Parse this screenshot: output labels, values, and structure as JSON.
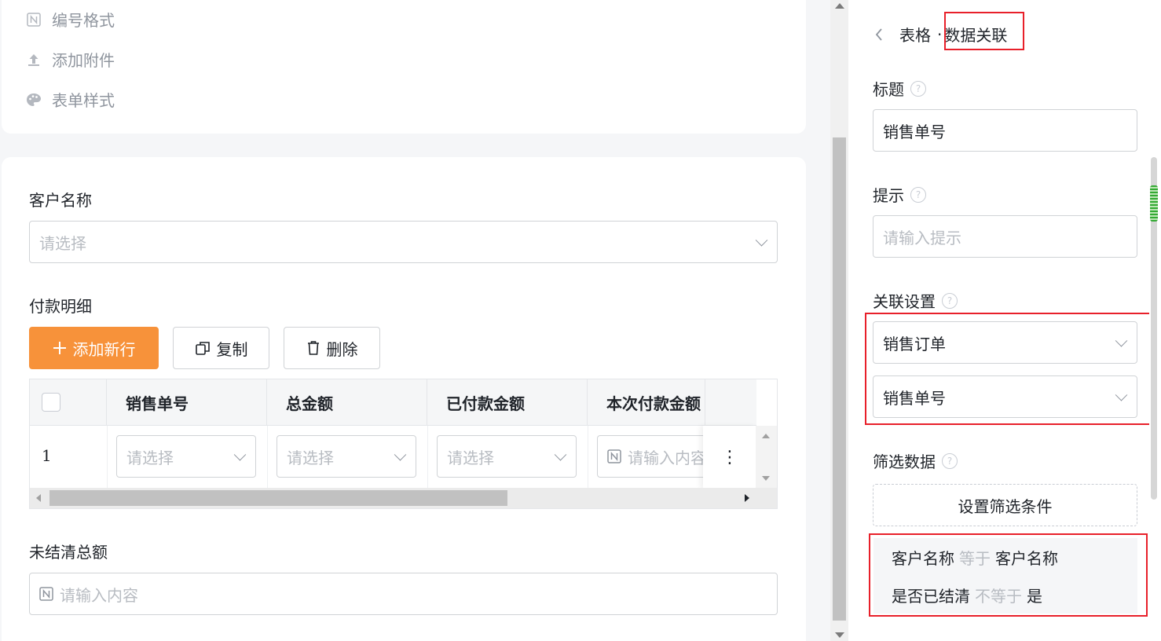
{
  "top_menu": {
    "items": [
      {
        "label": "编号格式",
        "icon": "number-icon"
      },
      {
        "label": "添加附件",
        "icon": "upload-icon"
      },
      {
        "label": "表单样式",
        "icon": "palette-icon"
      }
    ]
  },
  "form": {
    "customer": {
      "label": "客户名称",
      "placeholder": "请选择"
    },
    "payment_detail": {
      "label": "付款明细"
    },
    "buttons": {
      "add_row": "添加新行",
      "copy": "复制",
      "delete": "删除"
    },
    "table": {
      "headers": [
        "销售单号",
        "总金额",
        "已付款金额",
        "本次付款金额"
      ],
      "row": {
        "index": "1",
        "select_placeholder": "请选择",
        "input_placeholder": "请输入内容"
      }
    },
    "unsettled": {
      "label": "未结清总额",
      "placeholder": "请输入内容"
    }
  },
  "panel": {
    "breadcrumb_parent": "表格",
    "breadcrumb_sep": "·",
    "breadcrumb_current": "数据关联",
    "title_label": "标题",
    "title_value": "销售单号",
    "hint_label": "提示",
    "hint_placeholder": "请输入提示",
    "link_label": "关联设置",
    "link_form": "销售订单",
    "link_field": "销售单号",
    "filter_label": "筛选数据",
    "filter_button": "设置筛选条件",
    "conditions": [
      {
        "field": "客户名称",
        "op": "等于",
        "value": "客户名称"
      },
      {
        "field": "是否已结清",
        "op": "不等于",
        "value": "是"
      }
    ]
  },
  "colors": {
    "primary": "#f7923a",
    "highlight": "#e8202a",
    "placeholder": "#b8bcc2"
  }
}
